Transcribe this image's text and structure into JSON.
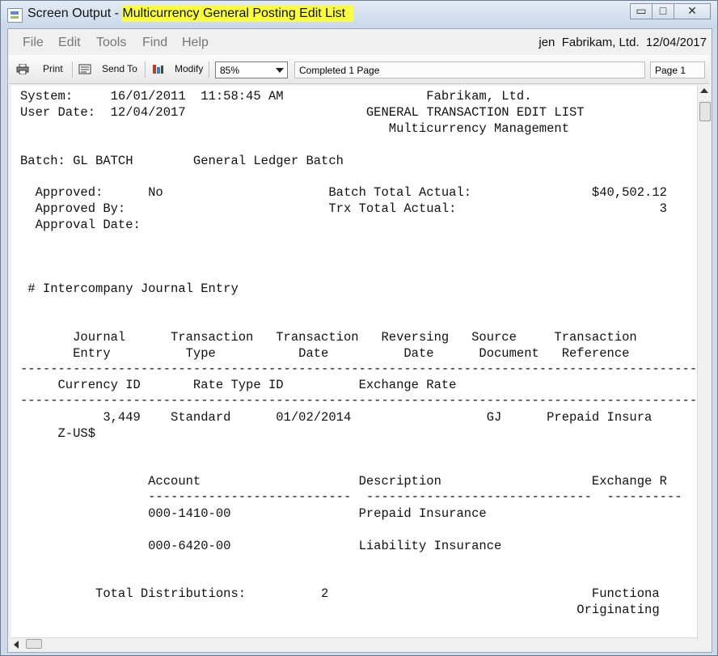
{
  "window": {
    "title_prefix": "Screen Output -",
    "title_highlight": "Multicurrency General Posting Edit List",
    "btn_min": "▭",
    "btn_max": "□",
    "btn_close": "✕"
  },
  "menubar": {
    "items": [
      "File",
      "Edit",
      "Tools",
      "Find",
      "Help"
    ],
    "company_info": "jen  Fabrikam, Ltd.  12/04/2017"
  },
  "toolbar": {
    "print": "Print",
    "send_to": "Send To",
    "modify": "Modify",
    "zoom": "85%",
    "status": "Completed 1 Page",
    "page": "Page 1"
  },
  "report": {
    "lines": [
      "System:     16/01/2011  11:58:45 AM",
      "                                                      Fabrikam, Ltd.",
      "User Date:  12/04/2017",
      "                                              GENERAL TRANSACTION EDIT LIST",
      "                                                 Multicurrency Management",
      "Batch: GL BATCH        General Ledger Batch",
      "  Approved:      No                      Batch Total Actual:                $40,502.12",
      "  Approved By:                           Trx Total Actual:                           3",
      "  Approval Date:",
      " # Intercompany Journal Entry",
      "       Journal      Transaction   Transaction   Reversing   Source     Transaction",
      "       Entry          Type           Date          Date      Document   Reference",
      "------------------------------------------------------------------------------------------",
      "     Currency ID       Rate Type ID          Exchange Rate",
      "------------------------------------------------------------------------------------------",
      "           3,449    Standard      01/02/2014                  GJ      Prepaid Insura",
      "     Z-US$",
      "                 Account                     Description                    Exchange R",
      "                 ---------------------------  ------------------------------  ----------",
      "                 000-1410-00                 Prepaid Insurance",
      "                 000-6420-00                 Liability Insurance",
      "          Total Distributions:          2                                   Functiona",
      "                                                                          Originating"
    ]
  }
}
